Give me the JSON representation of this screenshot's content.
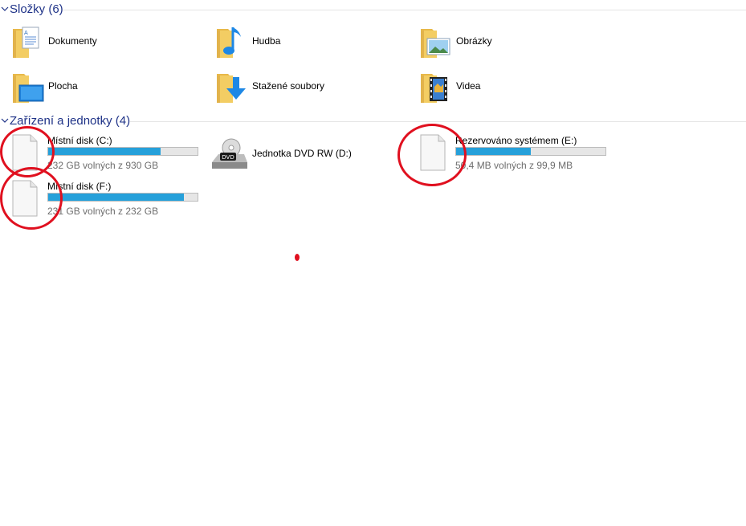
{
  "groups": {
    "folders": {
      "title": "Složky (6)"
    },
    "devices": {
      "title": "Zařízení a jednotky (4)"
    }
  },
  "folders": [
    {
      "label": "Dokumenty",
      "icon": "documents-folder-icon"
    },
    {
      "label": "Hudba",
      "icon": "music-folder-icon"
    },
    {
      "label": "Obrázky",
      "icon": "pictures-folder-icon"
    },
    {
      "label": "Plocha",
      "icon": "desktop-folder-icon"
    },
    {
      "label": "Stažené soubory",
      "icon": "downloads-folder-icon"
    },
    {
      "label": "Videa",
      "icon": "videos-folder-icon"
    }
  ],
  "drives": [
    {
      "name": "Místní disk (C:)",
      "free": "232 GB volných z 930 GB",
      "used_fraction": 0.75,
      "icon": "generic-drive-icon"
    },
    {
      "name": "Jednotka DVD RW (D:)",
      "icon": "dvd-drive-icon",
      "badge": "DVD"
    },
    {
      "name": "Rezervováno systémem (E:)",
      "free": "50,4 MB volných z 99,9 MB",
      "used_fraction": 0.5,
      "icon": "generic-drive-icon"
    },
    {
      "name": "Místní disk (F:)",
      "free": "231 GB volných z 232 GB",
      "used_fraction": 0.91,
      "icon": "generic-drive-icon"
    }
  ],
  "colors": {
    "header_text": "#1e3287",
    "bar_fill": "#26a0da",
    "annotation": "#e0101f"
  }
}
